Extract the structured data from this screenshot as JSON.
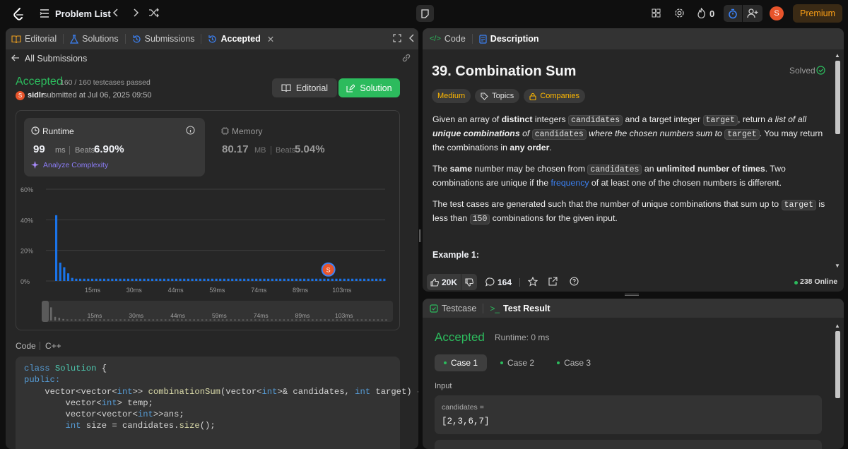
{
  "topbar": {
    "title": "Problem List",
    "streak": "0",
    "avatar": "S",
    "premium": "Premium"
  },
  "left_tabs": {
    "editorial": "Editorial",
    "solutions": "Solutions",
    "submissions": "Submissions",
    "accepted": "Accepted"
  },
  "back_label": "All Submissions",
  "submission": {
    "status": "Accepted",
    "testcases": "160 / 160 testcases passed",
    "avatar": "S",
    "user": "sidlr",
    "submitted": "submitted at Jul 06, 2025 09:50",
    "editorial_btn": "Editorial",
    "solution_btn": "Solution"
  },
  "runtime": {
    "label": "Runtime",
    "value": "99",
    "unit": "ms",
    "beats_label": "Beats",
    "beats": "6.90%",
    "analyze": "Analyze Complexity"
  },
  "memory": {
    "label": "Memory",
    "value": "80.17",
    "unit": "MB",
    "beats_label": "Beats",
    "beats": "5.04%"
  },
  "chart_data": {
    "type": "bar",
    "title": "",
    "xlabel": "",
    "ylabel": "",
    "ylim": [
      0,
      60
    ],
    "y_ticks": [
      "60%",
      "40%",
      "20%",
      "0%"
    ],
    "x_ticks": [
      "15ms",
      "30ms",
      "44ms",
      "59ms",
      "74ms",
      "89ms",
      "103ms"
    ],
    "mini_ticks": [
      "15ms",
      "30ms",
      "44ms",
      "59ms",
      "74ms",
      "89ms",
      "103ms"
    ],
    "values": [
      43,
      12,
      9,
      5,
      2,
      1.5,
      1.5,
      1.5,
      1.5,
      1.5,
      1.5,
      1.5,
      1.5,
      1.5,
      1.5,
      1.5,
      1.5,
      1.5,
      1.5,
      1.5,
      1.5,
      1.5,
      1.5,
      1.5,
      1.5,
      1.5,
      1.5,
      1.5,
      1.5,
      1.5,
      1.5,
      1.5,
      1.5,
      1.5,
      1.5,
      1.5,
      1.5,
      1.5,
      1.5,
      1.5,
      1.5,
      1.5,
      1.5,
      1.5,
      1.5,
      1.5,
      1.5,
      1.5,
      1.5,
      1.5,
      1.5,
      1.5,
      1.5,
      1.5,
      1.5,
      1.5,
      1.5,
      1.5,
      1.5,
      1.5,
      1.5,
      1.5,
      1.5,
      1.5,
      1.5,
      1.5,
      1.5,
      1.5,
      1.5,
      1.5,
      1.5,
      1.5,
      1.5,
      1.5,
      1.5,
      1.5,
      1.5,
      1.5,
      1.5,
      1.5,
      1.5,
      1.5,
      1.5
    ],
    "marker_index": 68,
    "marker_label": "S",
    "bar_color": "#1a73e8"
  },
  "code_section": {
    "label": "Code",
    "lang": "C++",
    "lines": [
      [
        {
          "t": "class ",
          "c": "k"
        },
        {
          "t": "Solution",
          "c": "t"
        },
        {
          "t": " {",
          "c": "p"
        }
      ],
      [
        {
          "t": "public:",
          "c": "k"
        }
      ],
      [
        {
          "t": "    vector<vector<",
          "c": "p"
        },
        {
          "t": "int",
          "c": "k"
        },
        {
          "t": ">> ",
          "c": "p"
        },
        {
          "t": "combinationSum",
          "c": "f"
        },
        {
          "t": "(vector<",
          "c": "p"
        },
        {
          "t": "int",
          "c": "k"
        },
        {
          "t": ">& candidates, ",
          "c": "p"
        },
        {
          "t": "int",
          "c": "k"
        },
        {
          "t": " target) {",
          "c": "p"
        }
      ],
      [
        {
          "t": "        vector<",
          "c": "p"
        },
        {
          "t": "int",
          "c": "k"
        },
        {
          "t": "> temp;",
          "c": "p"
        }
      ],
      [
        {
          "t": "        vector<vector<",
          "c": "p"
        },
        {
          "t": "int",
          "c": "k"
        },
        {
          "t": ">>ans;",
          "c": "p"
        }
      ],
      [
        {
          "t": "        ",
          "c": "p"
        },
        {
          "t": "int",
          "c": "k"
        },
        {
          "t": " size = candidates.",
          "c": "p"
        },
        {
          "t": "size",
          "c": "f"
        },
        {
          "t": "();",
          "c": "p"
        }
      ]
    ]
  },
  "right_tabs": {
    "code": "Code",
    "description": "Description"
  },
  "problem": {
    "title": "39. Combination Sum",
    "solved": "Solved",
    "difficulty": "Medium",
    "topics": "Topics",
    "companies": "Companies",
    "p1": [
      {
        "t": "Given an array of "
      },
      {
        "t": "distinct",
        "s": "b"
      },
      {
        "t": " integers "
      },
      {
        "t": "candidates",
        "s": "c"
      },
      {
        "t": " and a target integer "
      },
      {
        "t": "target",
        "s": "c"
      },
      {
        "t": ", return "
      },
      {
        "t": "a list of all ",
        "s": "i"
      },
      {
        "t": "unique combinations",
        "s": "bi"
      },
      {
        "t": " of ",
        "s": "i"
      },
      {
        "t": "candidates",
        "s": "c"
      },
      {
        "t": " where the chosen numbers sum to ",
        "s": "i"
      },
      {
        "t": "target",
        "s": "c"
      },
      {
        "t": ". You may return the combinations in "
      },
      {
        "t": "any order",
        "s": "b"
      },
      {
        "t": "."
      }
    ],
    "p2": [
      {
        "t": "The "
      },
      {
        "t": "same",
        "s": "b"
      },
      {
        "t": " number may be chosen from "
      },
      {
        "t": "candidates",
        "s": "c"
      },
      {
        "t": " an "
      },
      {
        "t": "unlimited number of times",
        "s": "b"
      },
      {
        "t": ". Two combinations are unique if the "
      },
      {
        "t": "frequency",
        "s": "l"
      },
      {
        "t": " of at least one of the chosen numbers is different."
      }
    ],
    "p3": [
      {
        "t": "The test cases are generated such that the number of unique combinations that sum up to "
      },
      {
        "t": "target",
        "s": "c"
      },
      {
        "t": " is less than "
      },
      {
        "t": "150",
        "s": "c"
      },
      {
        "t": " combinations for the given input."
      }
    ],
    "example": "Example 1:",
    "likes": "20K",
    "comments": "164",
    "online": "238 Online"
  },
  "bottom_tabs": {
    "testcase": "Testcase",
    "result": "Test Result"
  },
  "result": {
    "status": "Accepted",
    "runtime": "Runtime: 0 ms",
    "cases": [
      "Case 1",
      "Case 2",
      "Case 3"
    ],
    "input_label": "Input",
    "var_label": "candidates =",
    "var_value": "[2,3,6,7]"
  }
}
